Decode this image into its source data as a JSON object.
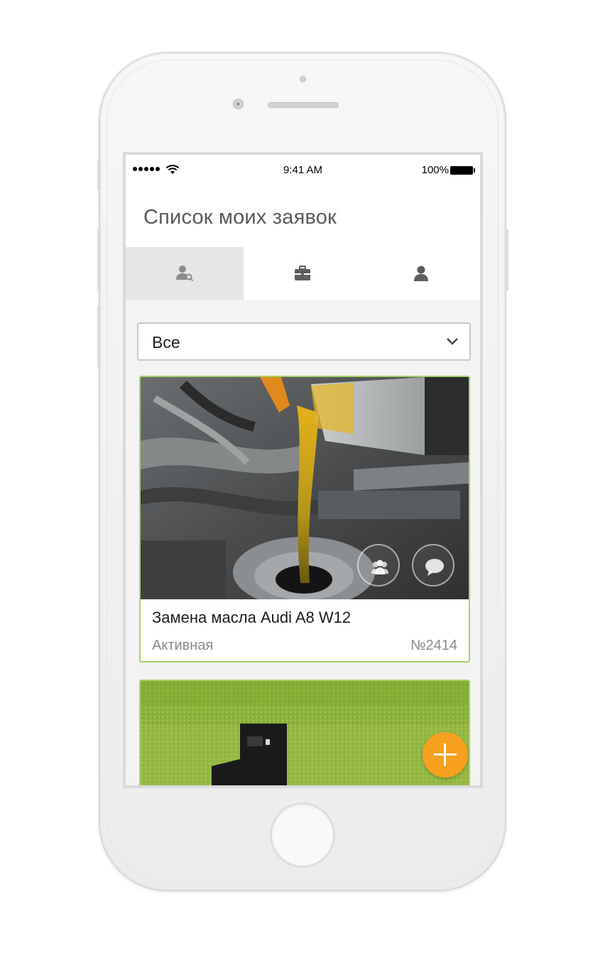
{
  "status_bar": {
    "time": "9:41 AM",
    "battery": "100%"
  },
  "header": {
    "title": "Список моих заявок"
  },
  "tabs": [
    {
      "icon": "user-search-icon",
      "active": true
    },
    {
      "icon": "briefcase-icon",
      "active": false
    },
    {
      "icon": "user-icon",
      "active": false
    }
  ],
  "filter": {
    "selected": "Все"
  },
  "requests": [
    {
      "title": "Замена масла Audi A8 W12",
      "status": "Активная",
      "number": "№2414",
      "image": "engine-oil-pour-photo"
    },
    {
      "image": "green-grass-photo"
    }
  ],
  "fab": {
    "icon": "plus-icon"
  },
  "colors": {
    "accent": "#f7a01d",
    "card_border": "#a7d36a",
    "title_text": "#5a5a5a"
  }
}
